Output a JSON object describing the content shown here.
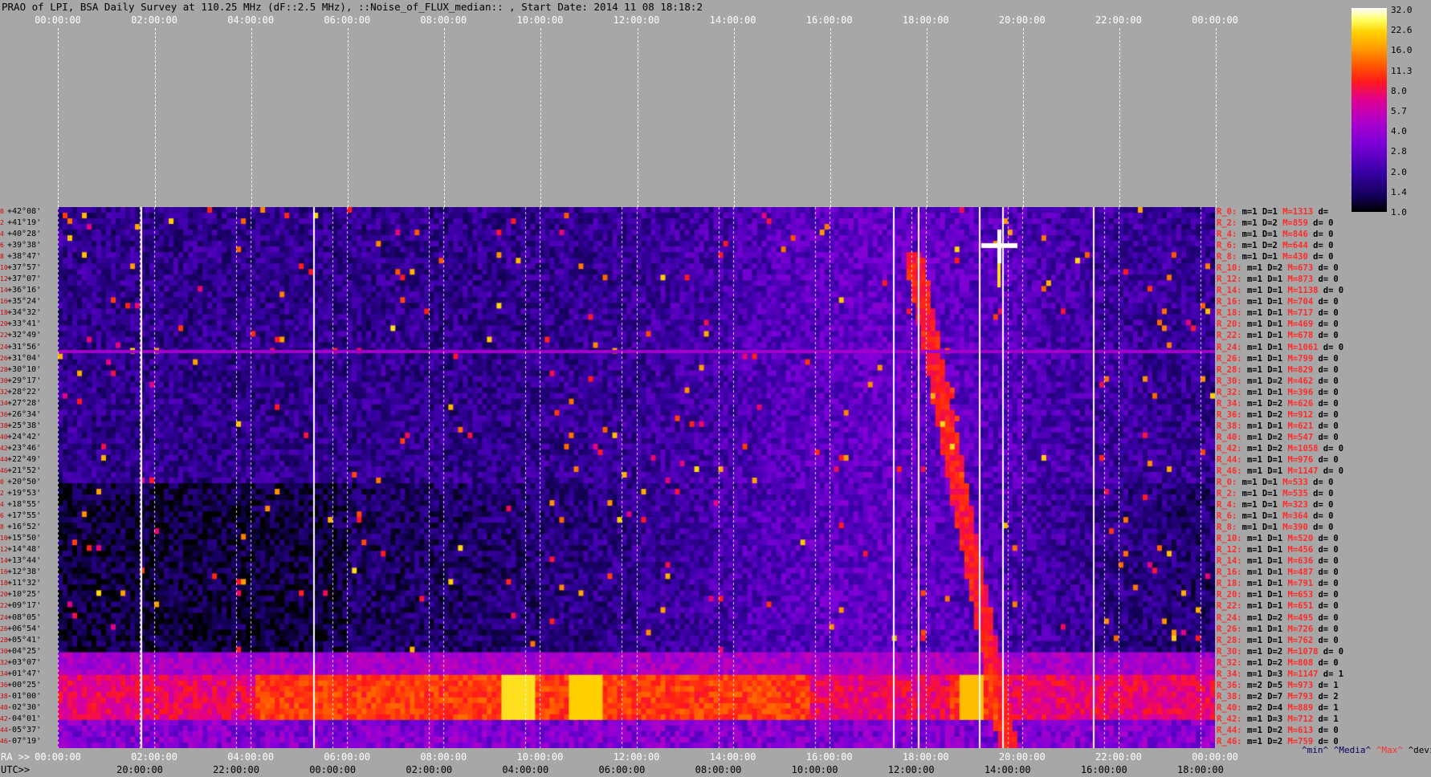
{
  "title": "PRAO of LPI, BSA Daily Survey at 110.25 MHz (dF::2.5 MHz), ::Noise_of_FLUX_median:: , Start Date: 2014 11 08 18:18:2",
  "top_time_labels": [
    "00:00:00",
    "02:00:00",
    "04:00:00",
    "06:00:00",
    "08:00:00",
    "10:00:00",
    "12:00:00",
    "14:00:00",
    "16:00:00",
    "18:00:00",
    "20:00:00",
    "22:00:00",
    "00:00:00"
  ],
  "ra_prefix": "RA >>",
  "ra_labels": [
    "00:00:00",
    "02:00:00",
    "04:00:00",
    "06:00:00",
    "08:00:00",
    "10:00:00",
    "12:00:00",
    "14:00:00",
    "16:00:00",
    "18:00:00",
    "20:00:00",
    "22:00:00",
    "00:00:00"
  ],
  "utc_prefix": "UTC>>",
  "utc_labels": [
    "20:00:00",
    "22:00:00",
    "00:00:00",
    "02:00:00",
    "04:00:00",
    "06:00:00",
    "08:00:00",
    "10:00:00",
    "12:00:00",
    "14:00:00",
    "16:00:00",
    "18:00:00"
  ],
  "declinations": [
    "+42°08'",
    "+41°19'",
    "+40°28'",
    "+39°38'",
    "+38°47'",
    "+37°57'",
    "+37°07'",
    "+36°16'",
    "+35°24'",
    "+34°32'",
    "+33°41'",
    "+32°49'",
    "+31°56'",
    "+31°04'",
    "+30°10'",
    "+29°17'",
    "+28°22'",
    "+27°28'",
    "+26°34'",
    "+25°38'",
    "+24°42'",
    "+23°46'",
    "+22°49'",
    "+21°52'",
    "+20°50'",
    "+19°53'",
    "+18°55'",
    "+17°55'",
    "+16°52'",
    "+15°50'",
    "+14°48'",
    "+13°44'",
    "+12°38'",
    "+11°32'",
    "+10°25'",
    "+09°17'",
    "+08°05'",
    "+06°54'",
    "+05°41'",
    "+04°25'",
    "+03°07'",
    "+01°47'",
    "+00°25'",
    "-01°00'",
    "-02°30'",
    "-04°01'",
    "-05°37'",
    "-07°19'"
  ],
  "dec_indices": [
    "0",
    "2",
    "4",
    "6",
    "8",
    "10",
    "12",
    "14",
    "16",
    "18",
    "20",
    "22",
    "24",
    "26",
    "28",
    "30",
    "32",
    "34",
    "36",
    "38",
    "40",
    "42",
    "44",
    "46",
    "0",
    "2",
    "4",
    "6",
    "8",
    "10",
    "12",
    "14",
    "16",
    "18",
    "20",
    "22",
    "24",
    "26",
    "28",
    "30",
    "32",
    "34",
    "36",
    "38",
    "40",
    "42",
    "44",
    "46"
  ],
  "stats_rows": [
    {
      "r": "R_0:",
      "m": "m=1",
      "D": "D=1",
      "M": "M=1313",
      "d": "d="
    },
    {
      "r": "R_2:",
      "m": "m=1",
      "D": "D=2",
      "M": "M=859",
      "d": "d= 0"
    },
    {
      "r": "R_4:",
      "m": "m=1",
      "D": "D=1",
      "M": "M=846",
      "d": "d= 0"
    },
    {
      "r": "R_6:",
      "m": "m=1",
      "D": "D=2",
      "M": "M=644",
      "d": "d= 0"
    },
    {
      "r": "R_8:",
      "m": "m=1",
      "D": "D=1",
      "M": "M=430",
      "d": "d= 0"
    },
    {
      "r": "R_10:",
      "m": "m=1",
      "D": "D=2",
      "M": "M=673",
      "d": "d= 0"
    },
    {
      "r": "R_12:",
      "m": "m=1",
      "D": "D=1",
      "M": "M=873",
      "d": "d= 0"
    },
    {
      "r": "R_14:",
      "m": "m=1",
      "D": "D=1",
      "M": "M=1138",
      "d": "d= 0"
    },
    {
      "r": "R_16:",
      "m": "m=1",
      "D": "D=1",
      "M": "M=704",
      "d": "d= 0"
    },
    {
      "r": "R_18:",
      "m": "m=1",
      "D": "D=1",
      "M": "M=717",
      "d": "d= 0"
    },
    {
      "r": "R_20:",
      "m": "m=1",
      "D": "D=1",
      "M": "M=469",
      "d": "d= 0"
    },
    {
      "r": "R_22:",
      "m": "m=1",
      "D": "D=1",
      "M": "M=678",
      "d": "d= 0"
    },
    {
      "r": "R_24:",
      "m": "m=1",
      "D": "D=1",
      "M": "M=1061",
      "d": "d= 0"
    },
    {
      "r": "R_26:",
      "m": "m=1",
      "D": "D=1",
      "M": "M=799",
      "d": "d= 0"
    },
    {
      "r": "R_28:",
      "m": "m=1",
      "D": "D=1",
      "M": "M=829",
      "d": "d= 0"
    },
    {
      "r": "R_30:",
      "m": "m=1",
      "D": "D=2",
      "M": "M=462",
      "d": "d= 0"
    },
    {
      "r": "R_32:",
      "m": "m=1",
      "D": "D=1",
      "M": "M=396",
      "d": "d= 0"
    },
    {
      "r": "R_34:",
      "m": "m=1",
      "D": "D=2",
      "M": "M=626",
      "d": "d= 0"
    },
    {
      "r": "R_36:",
      "m": "m=1",
      "D": "D=2",
      "M": "M=912",
      "d": "d= 0"
    },
    {
      "r": "R_38:",
      "m": "m=1",
      "D": "D=1",
      "M": "M=621",
      "d": "d= 0"
    },
    {
      "r": "R_40:",
      "m": "m=1",
      "D": "D=2",
      "M": "M=547",
      "d": "d= 0"
    },
    {
      "r": "R_42:",
      "m": "m=1",
      "D": "D=2",
      "M": "M=1058",
      "d": "d= 0"
    },
    {
      "r": "R_44:",
      "m": "m=1",
      "D": "D=1",
      "M": "M=976",
      "d": "d= 0"
    },
    {
      "r": "R_46:",
      "m": "m=1",
      "D": "D=1",
      "M": "M=1147",
      "d": "d= 0"
    },
    {
      "r": "R_0:",
      "m": "m=1",
      "D": "D=1",
      "M": "M=533",
      "d": "d= 0"
    },
    {
      "r": "R_2:",
      "m": "m=1",
      "D": "D=1",
      "M": "M=535",
      "d": "d= 0"
    },
    {
      "r": "R_4:",
      "m": "m=1",
      "D": "D=1",
      "M": "M=323",
      "d": "d= 0"
    },
    {
      "r": "R_6:",
      "m": "m=1",
      "D": "D=1",
      "M": "M=364",
      "d": "d= 0"
    },
    {
      "r": "R_8:",
      "m": "m=1",
      "D": "D=1",
      "M": "M=390",
      "d": "d= 0"
    },
    {
      "r": "R_10:",
      "m": "m=1",
      "D": "D=1",
      "M": "M=520",
      "d": "d= 0"
    },
    {
      "r": "R_12:",
      "m": "m=1",
      "D": "D=1",
      "M": "M=456",
      "d": "d= 0"
    },
    {
      "r": "R_14:",
      "m": "m=1",
      "D": "D=1",
      "M": "M=636",
      "d": "d= 0"
    },
    {
      "r": "R_16:",
      "m": "m=1",
      "D": "D=1",
      "M": "M=487",
      "d": "d= 0"
    },
    {
      "r": "R_18:",
      "m": "m=1",
      "D": "D=1",
      "M": "M=791",
      "d": "d= 0"
    },
    {
      "r": "R_20:",
      "m": "m=1",
      "D": "D=1",
      "M": "M=653",
      "d": "d= 0"
    },
    {
      "r": "R_22:",
      "m": "m=1",
      "D": "D=1",
      "M": "M=651",
      "d": "d= 0"
    },
    {
      "r": "R_24:",
      "m": "m=1",
      "D": "D=2",
      "M": "M=495",
      "d": "d= 0"
    },
    {
      "r": "R_26:",
      "m": "m=1",
      "D": "D=1",
      "M": "M=726",
      "d": "d= 0"
    },
    {
      "r": "R_28:",
      "m": "m=1",
      "D": "D=1",
      "M": "M=762",
      "d": "d= 0"
    },
    {
      "r": "R_30:",
      "m": "m=1",
      "D": "D=2",
      "M": "M=1078",
      "d": "d= 0"
    },
    {
      "r": "R_32:",
      "m": "m=1",
      "D": "D=2",
      "M": "M=808",
      "d": "d= 0"
    },
    {
      "r": "R_34:",
      "m": "m=1",
      "D": "D=3",
      "M": "M=1147",
      "d": "d= 1"
    },
    {
      "r": "R_36:",
      "m": "m=2",
      "D": "D=5",
      "M": "M=973",
      "d": "d= 1"
    },
    {
      "r": "R_38:",
      "m": "m=2",
      "D": "D=7",
      "M": "M=793",
      "d": "d= 2"
    },
    {
      "r": "R_40:",
      "m": "m=2",
      "D": "D=4",
      "M": "M=889",
      "d": "d= 1"
    },
    {
      "r": "R_42:",
      "m": "m=1",
      "D": "D=3",
      "M": "M=712",
      "d": "d= 1"
    },
    {
      "r": "R_44:",
      "m": "m=1",
      "D": "D=2",
      "M": "M=613",
      "d": "d= 0"
    },
    {
      "r": "R_46:",
      "m": "m=1",
      "D": "D=2",
      "M": "M=759",
      "d": "d= 0"
    }
  ],
  "legend": {
    "min": "^min^",
    "median": "^Media^",
    "max": "^Max^",
    "dev": "^devia^"
  },
  "colorbar_ticks": [
    "32.0",
    "22.6",
    "16.0",
    "11.3",
    "8.0",
    "5.7",
    "4.0",
    "2.8",
    "2.0",
    "1.4",
    "1.0"
  ],
  "colors": {
    "background": "#a7a7a7",
    "plot_bg": "#1a0a3a",
    "grid": "#ffffff",
    "stat_red": "#ff2a2a"
  },
  "chart_data": {
    "type": "heatmap",
    "title": "PRAO of LPI, BSA Daily Survey at 110.25 MHz (dF::2.5 MHz), ::Noise_of_FLUX_median:: , Start Date: 2014 11 08 18:18:2",
    "x_axis": "RA 00:00:00 – 24:00:00 (sidereal), with UTC secondary axis",
    "y_axis": "Declination +42°08' to -07°19' (48 beams)",
    "colorscale_range": [
      1.0,
      32.0
    ],
    "colorscale_log": true,
    "features": [
      {
        "name": "bright point source",
        "ra": "≈20:00",
        "dec": "+40°28'"
      },
      {
        "name": "horizontal band of strong interference",
        "dec_range": [
          "+00°25'",
          "-02°30'"
        ]
      },
      {
        "name": "diagonal drift feature",
        "ra_range": [
          "≈18:30",
          "≈20:00"
        ],
        "dec_range": [
          "-02°30'",
          "+40°00'"
        ]
      }
    ]
  }
}
